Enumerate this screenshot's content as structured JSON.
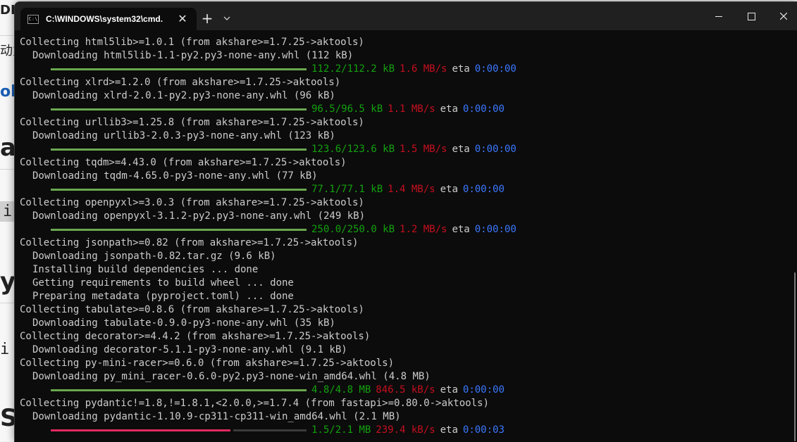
{
  "background_page": {
    "fragments": [
      "DI",
      "动力",
      "ols",
      "a",
      "i",
      "yr",
      "i",
      "Sh"
    ]
  },
  "window": {
    "tab_title": "C:\\WINDOWS\\system32\\cmd.",
    "tab_icon_text": "C:\\",
    "tab_close": "✕",
    "new_tab": "+",
    "dropdown": "⌄"
  },
  "console": {
    "blocks": [
      {
        "collecting": "Collecting html5lib>=1.0.1 (from akshare>=1.7.25->aktools)",
        "lines": [
          "Downloading html5lib-1.1-py2.py3-none-any.whl (112 kB)"
        ],
        "progress": {
          "amount": "112.2/112.2 kB",
          "speed": "1.6 MB/s",
          "eta_label": "eta",
          "eta": "0:00:00",
          "fraction": 1.0
        }
      },
      {
        "collecting": "Collecting xlrd>=1.2.0 (from akshare>=1.7.25->aktools)",
        "lines": [
          "Downloading xlrd-2.0.1-py2.py3-none-any.whl (96 kB)"
        ],
        "progress": {
          "amount": "96.5/96.5 kB",
          "speed": "1.1 MB/s",
          "eta_label": "eta",
          "eta": "0:00:00",
          "fraction": 1.0
        }
      },
      {
        "collecting": "Collecting urllib3>=1.25.8 (from akshare>=1.7.25->aktools)",
        "lines": [
          "Downloading urllib3-2.0.3-py3-none-any.whl (123 kB)"
        ],
        "progress": {
          "amount": "123.6/123.6 kB",
          "speed": "1.5 MB/s",
          "eta_label": "eta",
          "eta": "0:00:00",
          "fraction": 1.0
        }
      },
      {
        "collecting": "Collecting tqdm>=4.43.0 (from akshare>=1.7.25->aktools)",
        "lines": [
          "Downloading tqdm-4.65.0-py3-none-any.whl (77 kB)"
        ],
        "progress": {
          "amount": "77.1/77.1 kB",
          "speed": "1.4 MB/s",
          "eta_label": "eta",
          "eta": "0:00:00",
          "fraction": 1.0
        }
      },
      {
        "collecting": "Collecting openpyxl>=3.0.3 (from akshare>=1.7.25->aktools)",
        "lines": [
          "Downloading openpyxl-3.1.2-py2.py3-none-any.whl (249 kB)"
        ],
        "progress": {
          "amount": "250.0/250.0 kB",
          "speed": "1.2 MB/s",
          "eta_label": "eta",
          "eta": "0:00:00",
          "fraction": 1.0
        }
      },
      {
        "collecting": "Collecting jsonpath>=0.82 (from akshare>=1.7.25->aktools)",
        "lines": [
          "Downloading jsonpath-0.82.tar.gz (9.6 kB)",
          "Installing build dependencies ... done",
          "Getting requirements to build wheel ... done",
          "Preparing metadata (pyproject.toml) ... done"
        ],
        "progress": null
      },
      {
        "collecting": "Collecting tabulate>=0.8.6 (from akshare>=1.7.25->aktools)",
        "lines": [
          "Downloading tabulate-0.9.0-py3-none-any.whl (35 kB)"
        ],
        "progress": null
      },
      {
        "collecting": "Collecting decorator>=4.4.2 (from akshare>=1.7.25->aktools)",
        "lines": [
          "Downloading decorator-5.1.1-py3-none-any.whl (9.1 kB)"
        ],
        "progress": null
      },
      {
        "collecting": "Collecting py-mini-racer>=0.6.0 (from akshare>=1.7.25->aktools)",
        "lines": [
          "Downloading py_mini_racer-0.6.0-py2.py3-none-win_amd64.whl (4.8 MB)"
        ],
        "progress": {
          "amount": "4.8/4.8 MB",
          "speed": "846.5 kB/s",
          "eta_label": "eta",
          "eta": "0:00:00",
          "fraction": 1.0
        }
      },
      {
        "collecting": "Collecting pydantic!=1.8,!=1.8.1,<2.0.0,>=1.7.4 (from fastapi>=0.80.0->aktools)",
        "lines": [
          "Downloading pydantic-1.10.9-cp311-cp311-win_amd64.whl (2.1 MB)"
        ],
        "progress": {
          "amount": "1.5/2.1 MB",
          "speed": "239.4 kB/s",
          "eta_label": "eta",
          "eta": "0:00:03",
          "fraction": 0.71
        }
      }
    ]
  },
  "colors": {
    "bar_complete": "#6aa84f",
    "bar_partial": "#e0295f",
    "bar_remaining": "#3a3a3a",
    "amount": "#13a10e",
    "speed": "#c50f1f",
    "eta": "#3b78ff"
  }
}
